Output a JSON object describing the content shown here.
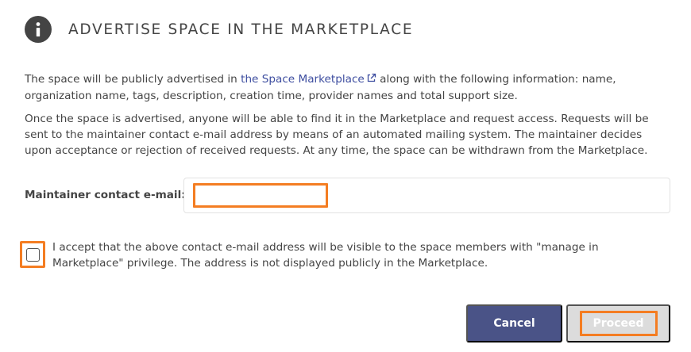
{
  "modal": {
    "title": "ADVERTISE SPACE IN THE MARKETPLACE",
    "info_icon": "info-icon",
    "paragraph1": {
      "before_link": "The space will be publicly advertised in ",
      "link_text": "the Space Marketplace",
      "link_icon": "external-link-icon",
      "after_link": " along with the following information: name, organization name, tags, description, creation time, provider names and total support size."
    },
    "paragraph2": "Once the space is advertised, anyone will be able to find it in the Marketplace and request access. Requests will be sent to the maintainer contact e-mail address by means of an automated mailing system. The maintainer decides upon acceptance or rejection of received requests. At any time, the space can be withdrawn from the Marketplace.",
    "email": {
      "label": "Maintainer contact e-mail:",
      "value": "",
      "placeholder": ""
    },
    "consent": {
      "checked": false,
      "label": "I accept that the above contact e-mail address will be visible to the space members with \"manage in Marketplace\" privilege. The address is not displayed publicly in the Marketplace."
    },
    "buttons": {
      "cancel_label": "Cancel",
      "proceed_label": "Proceed"
    },
    "colors": {
      "accent": "#f47d22",
      "link": "#3e4ea0",
      "cancel_bg": "#4a5387",
      "proceed_bg_disabled": "#dcdcdc"
    }
  }
}
